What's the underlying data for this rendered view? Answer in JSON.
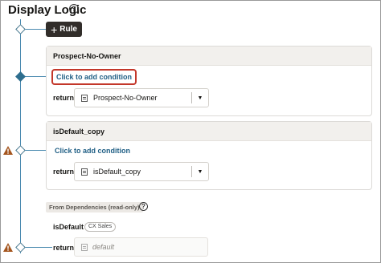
{
  "page": {
    "title": "Display Logic",
    "help_glyph": "?"
  },
  "toolbar": {
    "add_rule_plus": "+",
    "add_rule_label": "Rule"
  },
  "rules": [
    {
      "name": "Prospect-No-Owner",
      "add_condition": "Click to add condition",
      "return_label": "return",
      "return_value": "Prospect-No-Owner",
      "selected": true
    },
    {
      "name": "isDefault_copy",
      "add_condition": "Click to add condition",
      "return_label": "return",
      "return_value": "isDefault_copy",
      "warning": true
    }
  ],
  "dependencies": {
    "label": "From Dependencies (read-only)",
    "help_glyph": "?",
    "rule_name": "isDefault",
    "badge": "CX Sales",
    "return_label": "return",
    "return_value": "default",
    "warning": true
  },
  "colors": {
    "accent": "#2e6e8e",
    "link": "#1f5e84",
    "focus_outline": "#c3372a",
    "warning": "#a4551e",
    "button_dark": "#312d2a"
  },
  "icons": {
    "help": "help-icon",
    "plus": "plus-icon",
    "document": "document-icon",
    "caret": "chevron-down-icon",
    "warning": "warning-icon"
  }
}
